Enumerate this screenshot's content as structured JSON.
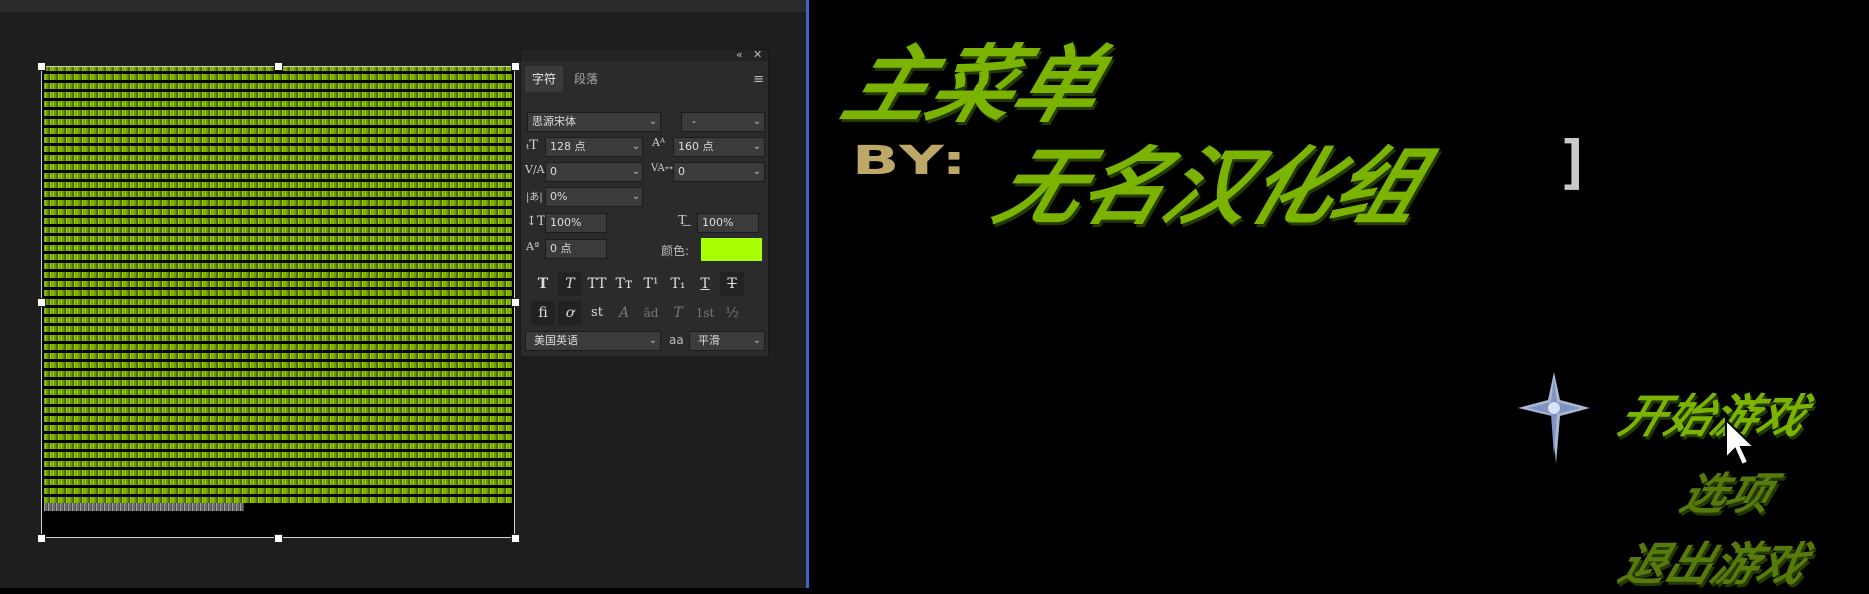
{
  "char_panel": {
    "tabs": [
      "字符",
      "段落"
    ],
    "font_family": "思源宋体",
    "font_style": "-",
    "font_size": "128 点",
    "leading": "160 点",
    "kerning": "0",
    "tracking": "0",
    "tsume": "0%",
    "vertical_scale": "100%",
    "horizontal_scale": "100%",
    "baseline_shift": "0 点",
    "color_label": "颜色:",
    "color_value": "#a8ff00",
    "language": "美国英语",
    "aa_label": "aa",
    "antialias": "平滑",
    "style_buttons": [
      "T",
      "T",
      "TT",
      "Tт",
      "T¹",
      "T₁",
      "T",
      "T"
    ],
    "opentype_buttons": [
      "ﬁ",
      "ơ",
      "st",
      "A",
      "ād",
      "T",
      "1st",
      "½"
    ]
  },
  "game": {
    "title": "主菜单",
    "by_label": "BY:",
    "credit": "无名汉化组",
    "bracket": "]",
    "menu": {
      "start": "开始游戏",
      "options": "选项",
      "exit": "退出游戏"
    },
    "accent_color": "#7ab300"
  }
}
